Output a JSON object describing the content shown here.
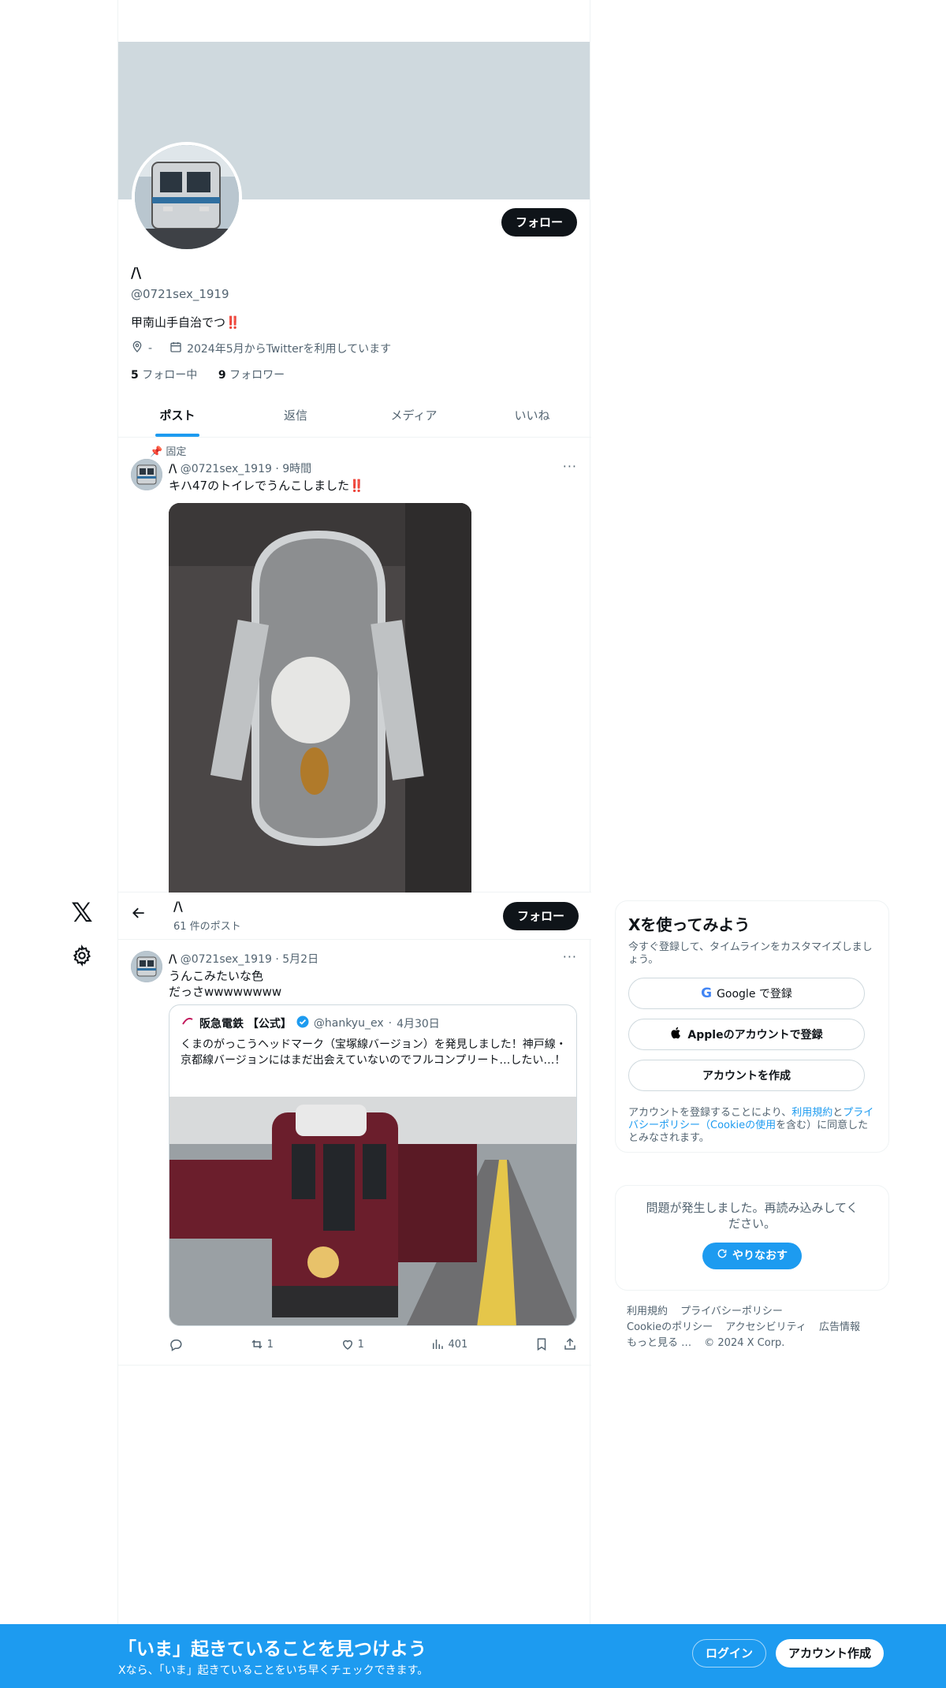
{
  "profile": {
    "name": "/\\",
    "handle": "@0721sex_1919",
    "bio": "甲南山手自治でつ‼️",
    "location": "-",
    "joined": "2024年5月からTwitterを利用しています",
    "following_count": "5",
    "following_label": "フォロー中",
    "followers_count": "9",
    "followers_label": "フォロワー",
    "follow_label": "フォロー"
  },
  "tabs": [
    {
      "label": "ポスト"
    },
    {
      "label": "返信"
    },
    {
      "label": "メディア"
    },
    {
      "label": "いいね"
    }
  ],
  "sticky": {
    "name": "/\\",
    "post_count": "61 件のポスト",
    "follow_label": "フォロー"
  },
  "posts": [
    {
      "pinned_label": "固定",
      "name": "/\\",
      "handle": "@0721sex_1919",
      "time": "9時間",
      "text": "キハ47のトイレでうんこしました‼️"
    },
    {
      "name": "/\\",
      "handle": "@0721sex_1919",
      "time": "5月2日",
      "text_line1": "うんこみたいな色",
      "text_line2": "だっさwwwwwwww",
      "quote": {
        "name": "阪急電鉄 【公式】",
        "handle": "@hankyu_ex",
        "time": "4月30日",
        "text": "くまのがっこうヘッドマーク（宝塚線バージョン）を発見しました！神戸線・京都線バージョンにはまだ出会えていないのでフルコンプリート…したい…！"
      },
      "retweets": "1",
      "likes": "1",
      "views": "401"
    }
  ],
  "signup_card": {
    "title": "Xを使ってみよう",
    "subtitle": "今すぐ登録して、タイムラインをカスタマイズしましょう。",
    "google_label": "Google で登録",
    "apple_label": "Appleのアカウントで登録",
    "create_label": "アカウントを作成",
    "tos_pre": "アカウントを登録することにより、",
    "tos_terms": "利用規約",
    "tos_and": "と",
    "tos_privacy": "プライバシーポリシー（Cookieの使用",
    "tos_post": "を含む）に同意したとみなされます。"
  },
  "error_card": {
    "message": "問題が発生しました。再読み込みしてください。",
    "retry_label": "やりなおす"
  },
  "footer": {
    "terms": "利用規約",
    "privacy": "プライバシーポリシー",
    "cookie": "Cookieのポリシー",
    "accessibility": "アクセシビリティ",
    "ads": "広告情報",
    "more": "もっと見る …",
    "copyright": "© 2024 X Corp."
  },
  "bottom_bar": {
    "title": "「いま」起きていることを見つけよう",
    "subtitle": "Xなら、「いま」起きていることをいち早くチェックできます。",
    "login_label": "ログイン",
    "signup_label": "アカウント作成"
  },
  "colors": {
    "accent": "#1d9bf0",
    "banner": "#cfd9de",
    "text": "#0f1419",
    "muted": "#536471"
  }
}
